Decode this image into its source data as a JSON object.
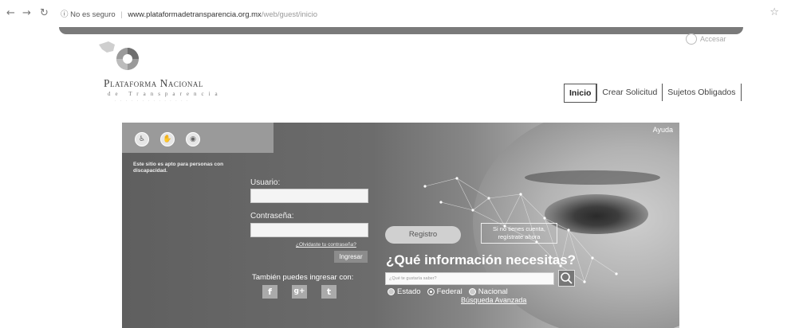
{
  "browser": {
    "security_label": "No es seguro",
    "url_domain": "www.plataformadetransparencia.org.mx",
    "url_path": "/web/guest/inicio"
  },
  "header": {
    "accessibility_label": "Accesar",
    "brand_line1": "Plataforma Nacional",
    "brand_line2": "de Transparencia"
  },
  "nav": {
    "tabs": [
      {
        "label": "Inicio",
        "active": true
      },
      {
        "label": "Crear Solicitud",
        "active": false
      },
      {
        "label": "Sujetos Obligados",
        "active": false
      }
    ]
  },
  "hero": {
    "help_label": "Ayuda",
    "access_note": "Este sitio es apto para personas con discapacidad.",
    "login": {
      "user_label": "Usuario:",
      "password_label": "Contraseña:",
      "forgot_link": "¿Olvidaste tu contraseña?",
      "submit_label": "Ingresar",
      "social_label": "También puedes ingresar con:",
      "social_icons": [
        "facebook-icon",
        "google-plus-icon",
        "twitter-icon"
      ]
    },
    "register": {
      "button_label": "Registro",
      "hint": "Si no tienes cuenta, regístrate ahora"
    },
    "search": {
      "question": "¿Qué información necesitas?",
      "placeholder": "¿Qué te gustaría saber?",
      "scopes": [
        {
          "label": "Estado",
          "selected": false
        },
        {
          "label": "Federal",
          "selected": true
        },
        {
          "label": "Nacional",
          "selected": false
        }
      ],
      "advanced_link": "Búsqueda Avanzada"
    }
  }
}
